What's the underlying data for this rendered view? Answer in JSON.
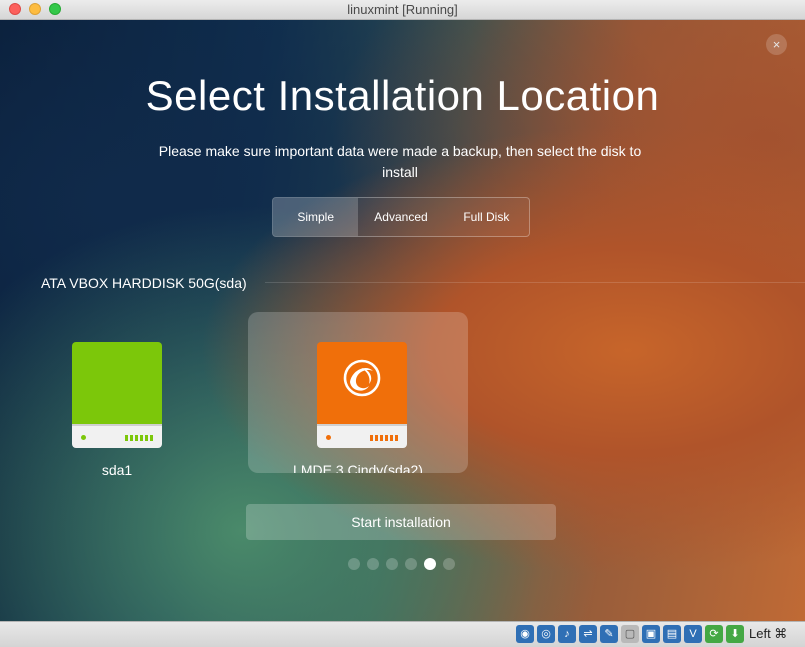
{
  "window": {
    "title": "linuxmint [Running]"
  },
  "installer": {
    "heading": "Select Installation Location",
    "subtitle": "Please make sure important data were made a backup, then select the disk to install",
    "close_glyph": "×",
    "modes": [
      {
        "label": "Simple",
        "selected": true
      },
      {
        "label": "Advanced",
        "selected": false
      },
      {
        "label": "Full Disk",
        "selected": false
      }
    ],
    "disk_name": "ATA VBOX HARDDISK 50G(sda)",
    "partitions": [
      {
        "name": "sda1",
        "color": "#7cc70a",
        "icon": "hard-drive-icon",
        "selected": false
      },
      {
        "name": "LMDE 3 Cindy(sda2)",
        "color": "#f06f0a",
        "icon": "deepin-logo-drive-icon",
        "selected": true
      }
    ],
    "start_label": "Start installation",
    "pager": {
      "total": 6,
      "current": 5
    }
  },
  "statusbar": {
    "icons": [
      "hard-disk-icon",
      "optical-drive-icon",
      "audio-icon",
      "usb-icon",
      "shared-folder-icon",
      "display-icon",
      "screen-icon",
      "recording-icon",
      "video-capture-icon",
      "network-icon",
      "mouse-integration-icon"
    ],
    "host_key_label": "Left ⌘"
  },
  "colors": {
    "accent_green": "#7cc70a",
    "accent_orange": "#f06f0a"
  }
}
